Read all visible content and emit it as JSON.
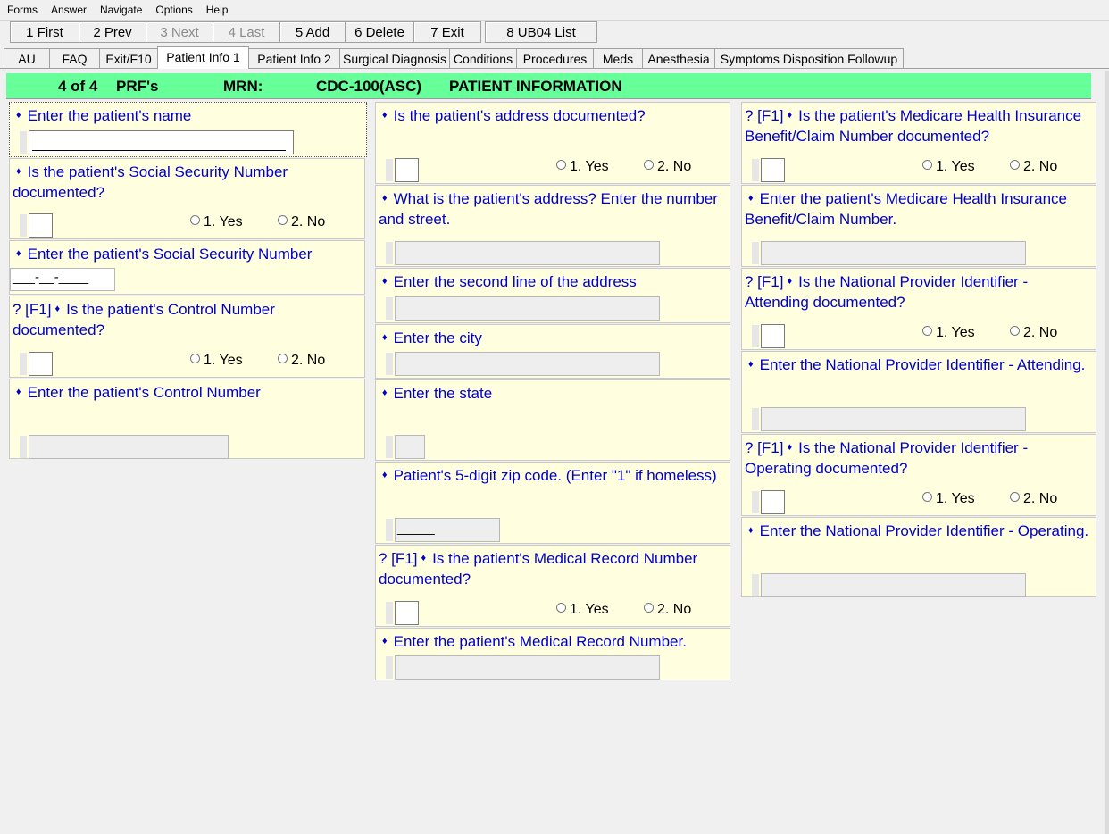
{
  "menu": [
    "Forms",
    "Answer",
    "Navigate",
    "Options",
    "Help"
  ],
  "toolbar": [
    {
      "key": "1",
      "label": " First",
      "enabled": true
    },
    {
      "key": "2",
      "label": " Prev",
      "enabled": true
    },
    {
      "key": "3",
      "label": " Next",
      "enabled": false
    },
    {
      "key": "4",
      "label": " Last",
      "enabled": false
    },
    {
      "key": "5",
      "label": " Add",
      "enabled": true
    },
    {
      "key": "6",
      "label": " Delete",
      "enabled": true
    },
    {
      "key": "7",
      "label": " Exit",
      "enabled": true
    },
    {
      "key": "8",
      "label": " UB04 List",
      "enabled": true
    }
  ],
  "tabs": [
    "AU",
    "FAQ",
    "Exit/F10",
    "Patient Info 1",
    "Patient Info 2",
    "Surgical Diagnosis",
    "Conditions",
    "Procedures",
    "Meds",
    "Anesthesia",
    "Symptoms Disposition Followup"
  ],
  "active_tab": "Patient Info 1",
  "header": {
    "record": "4 of 4",
    "prf": "PRF's",
    "mrn_label": "MRN:",
    "form": "CDC-100(ASC)",
    "section": "PATIENT INFORMATION"
  },
  "colors": {
    "header_bg": "#66ff99",
    "cell_bg": "#ffffe0",
    "question_text": "#0000cc"
  },
  "common": {
    "diamond": "♦",
    "help": "? [F1]",
    "yes": "1. Yes",
    "no": "2. No"
  },
  "ssn_mask": "___-__-____",
  "zip_mask": "_____",
  "questions": {
    "patient_name": "Enter the patient's name",
    "ssn_doc": "Is the patient's Social Security Number documented?",
    "ssn": "Enter the patient's Social Security Number",
    "control_doc": "Is the patient's Control Number documented?",
    "control": "Enter the patient's Control Number",
    "addr_doc": "Is the patient's address documented?",
    "addr_line1": "What is the patient's address? Enter the number and street.",
    "addr_line2": "Enter the second line of the address",
    "city": "Enter the city",
    "state": "Enter the state",
    "zip": "Patient's 5-digit zip code. (Enter \"1\" if homeless)",
    "mrn_doc": "Is the patient's Medical Record Number documented?",
    "mrn": "Enter the patient's Medical Record Number.",
    "medicare_doc": "Is the patient's Medicare Health Insurance Benefit/Claim Number documented?",
    "medicare": "Enter the patient's Medicare Health Insurance Benefit/Claim Number.",
    "npi_att_doc": "Is the National Provider Identifier - Attending documented?",
    "npi_att": "Enter the National Provider Identifier - Attending.",
    "npi_op_doc": "Is the National Provider Identifier - Operating documented?",
    "npi_op": "Enter the National Provider Identifier - Operating."
  }
}
